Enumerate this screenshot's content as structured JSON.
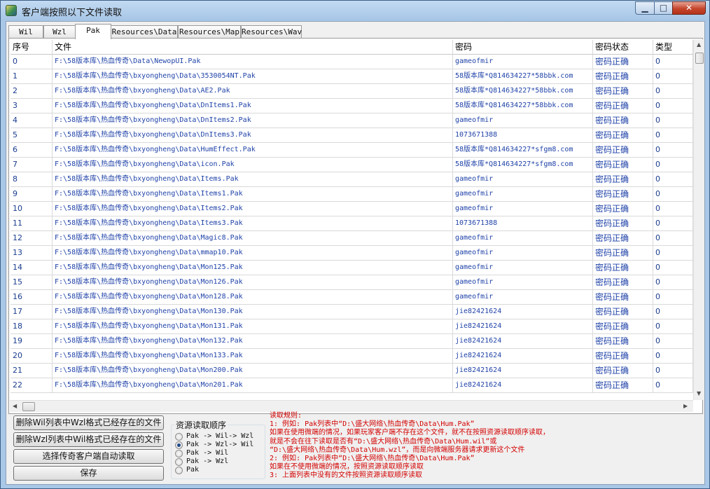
{
  "window": {
    "title": "客户端按照以下文件读取",
    "minimize": "▁",
    "maximize": "□",
    "close": "✕"
  },
  "tabs": [
    {
      "label": "Wil",
      "active": false
    },
    {
      "label": "Wzl",
      "active": false
    },
    {
      "label": "Pak",
      "active": true
    },
    {
      "label": "Resources\\Data",
      "active": false
    },
    {
      "label": "Resources\\Map",
      "active": false
    },
    {
      "label": "Resources\\Wav",
      "active": false
    }
  ],
  "table": {
    "headers": [
      "序号",
      "文件",
      "密码",
      "密码状态",
      "类型"
    ],
    "rows": [
      [
        "0",
        "F:\\58版本库\\热血传奇\\Data\\NewopUI.Pak",
        "gameofmir",
        "密码正确",
        "0"
      ],
      [
        "1",
        "F:\\58版本库\\热血传奇\\bxyongheng\\Data\\3530054NT.Pak",
        "58版本库*Q814634227*58bbk.com",
        "密码正确",
        "0"
      ],
      [
        "2",
        "F:\\58版本库\\热血传奇\\bxyongheng\\Data\\AE2.Pak",
        "58版本库*Q814634227*58bbk.com",
        "密码正确",
        "0"
      ],
      [
        "3",
        "F:\\58版本库\\热血传奇\\bxyongheng\\Data\\DnItems1.Pak",
        "58版本库*Q814634227*58bbk.com",
        "密码正确",
        "0"
      ],
      [
        "4",
        "F:\\58版本库\\热血传奇\\bxyongheng\\Data\\DnItems2.Pak",
        "gameofmir",
        "密码正确",
        "0"
      ],
      [
        "5",
        "F:\\58版本库\\热血传奇\\bxyongheng\\Data\\DnItems3.Pak",
        "1073671388",
        "密码正确",
        "0"
      ],
      [
        "6",
        "F:\\58版本库\\热血传奇\\bxyongheng\\Data\\HumEffect.Pak",
        "58版本库*Q814634227*sfgm8.com",
        "密码正确",
        "0"
      ],
      [
        "7",
        "F:\\58版本库\\热血传奇\\bxyongheng\\Data\\icon.Pak",
        "58版本库*Q814634227*sfgm8.com",
        "密码正确",
        "0"
      ],
      [
        "8",
        "F:\\58版本库\\热血传奇\\bxyongheng\\Data\\Items.Pak",
        "gameofmir",
        "密码正确",
        "0"
      ],
      [
        "9",
        "F:\\58版本库\\热血传奇\\bxyongheng\\Data\\Items1.Pak",
        "gameofmir",
        "密码正确",
        "0"
      ],
      [
        "10",
        "F:\\58版本库\\热血传奇\\bxyongheng\\Data\\Items2.Pak",
        "gameofmir",
        "密码正确",
        "0"
      ],
      [
        "11",
        "F:\\58版本库\\热血传奇\\bxyongheng\\Data\\Items3.Pak",
        "1073671388",
        "密码正确",
        "0"
      ],
      [
        "12",
        "F:\\58版本库\\热血传奇\\bxyongheng\\Data\\Magic8.Pak",
        "gameofmir",
        "密码正确",
        "0"
      ],
      [
        "13",
        "F:\\58版本库\\热血传奇\\bxyongheng\\Data\\mmap10.Pak",
        "gameofmir",
        "密码正确",
        "0"
      ],
      [
        "14",
        "F:\\58版本库\\热血传奇\\bxyongheng\\Data\\Mon125.Pak",
        "gameofmir",
        "密码正确",
        "0"
      ],
      [
        "15",
        "F:\\58版本库\\热血传奇\\bxyongheng\\Data\\Mon126.Pak",
        "gameofmir",
        "密码正确",
        "0"
      ],
      [
        "16",
        "F:\\58版本库\\热血传奇\\bxyongheng\\Data\\Mon128.Pak",
        "gameofmir",
        "密码正确",
        "0"
      ],
      [
        "17",
        "F:\\58版本库\\热血传奇\\bxyongheng\\Data\\Mon130.Pak",
        "jie82421624",
        "密码正确",
        "0"
      ],
      [
        "18",
        "F:\\58版本库\\热血传奇\\bxyongheng\\Data\\Mon131.Pak",
        "jie82421624",
        "密码正确",
        "0"
      ],
      [
        "19",
        "F:\\58版本库\\热血传奇\\bxyongheng\\Data\\Mon132.Pak",
        "jie82421624",
        "密码正确",
        "0"
      ],
      [
        "20",
        "F:\\58版本库\\热血传奇\\bxyongheng\\Data\\Mon133.Pak",
        "jie82421624",
        "密码正确",
        "0"
      ],
      [
        "21",
        "F:\\58版本库\\热血传奇\\bxyongheng\\Data\\Mon200.Pak",
        "jie82421624",
        "密码正确",
        "0"
      ],
      [
        "22",
        "F:\\58版本库\\热血传奇\\bxyongheng\\Data\\Mon201.Pak",
        "jie82421624",
        "密码正确",
        "0"
      ]
    ]
  },
  "buttons": {
    "delete_wil": "删除Wil列表中Wzl格式已经存在的文件",
    "delete_wzl": "删除Wzl列表中Wil格式已经存在的文件",
    "auto_read": "选择传奇客户端自动读取",
    "save": "保存"
  },
  "read_order": {
    "title": "资源读取顺序",
    "options": [
      {
        "label": "Pak -> Wil-> Wzl",
        "selected": false
      },
      {
        "label": "Pak -> Wzl-> Wil",
        "selected": true
      },
      {
        "label": "Pak -> Wil",
        "selected": false
      },
      {
        "label": "Pak -> Wzl",
        "selected": false
      },
      {
        "label": "Pak",
        "selected": false
      }
    ]
  },
  "rules": [
    "读取规则:",
    "1: 例如: Pak列表中“D:\\盛大网络\\热血传奇\\Data\\Hum.Pak”",
    "    如果在使用微端的情况，如果玩家客户端不存在这个文件，就不在按照资源读取顺序读取，",
    "    就是不会在往下读取是否有“D:\\盛大网络\\热血传奇\\Data\\Hum.wil”或",
    "    “D:\\盛大网络\\热血传奇\\Data\\Hum.wzl”，而是向微端服务器请求更新这个文件",
    "2: 例如: Pak列表中“D:\\盛大网络\\热血传奇\\Data\\Hum.Pak”",
    "    如果在不使用微端的情况，按照资源读取顺序读取",
    "3: 上面列表中没有的文件按照资源读取顺序读取"
  ],
  "colors": {
    "file_text": "#2043a8",
    "rules_text": "#d40000",
    "titlebar": "#a7c6e6"
  }
}
